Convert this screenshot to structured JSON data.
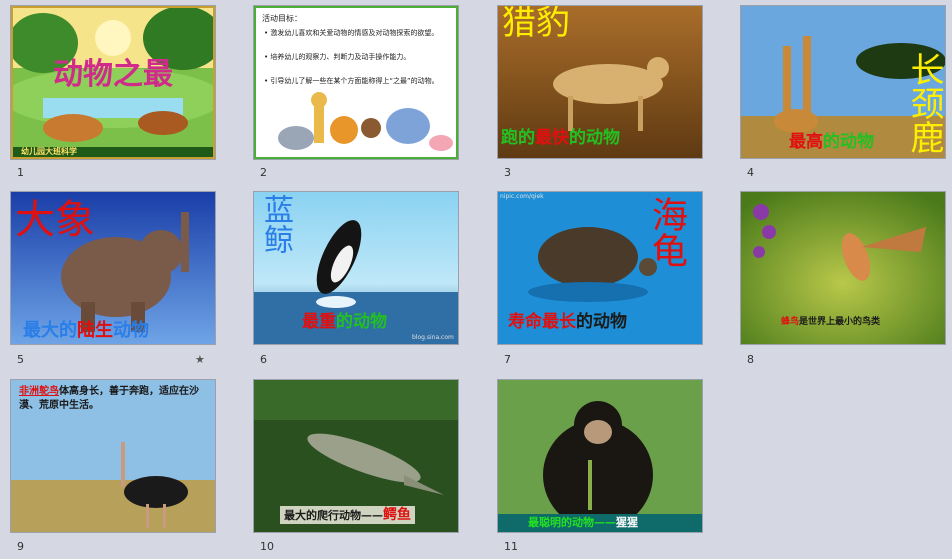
{
  "slides": [
    {
      "num": "1",
      "title": "动物之最",
      "footer": "幼儿园大班科学"
    },
    {
      "num": "2",
      "heading": "活动目标：",
      "bullets": [
        "激发幼儿喜欢和关爱动物的情感及对动物探索的欲望。",
        "培养幼儿的观察力、判断力及动手操作能力。",
        "引导幼儿了解一些在某个方面能称得上“之最”的动物。"
      ]
    },
    {
      "num": "3",
      "title": "猎豹",
      "cap_a": "跑的",
      "cap_b": "最快",
      "cap_c": "的动物"
    },
    {
      "num": "4",
      "title": "长颈鹿",
      "cap_a": "最高",
      "cap_b": "的动物"
    },
    {
      "num": "5",
      "title": "大象",
      "cap_a": "最大的",
      "cap_b": "陆生",
      "cap_c": "动物",
      "star": "★"
    },
    {
      "num": "6",
      "title": "蓝鲸",
      "cap_a": "最重",
      "cap_b": "的动物",
      "watermark": "blog.sina.com"
    },
    {
      "num": "7",
      "title": "海龟",
      "cap_a": "寿命最长",
      "cap_b": "的动物",
      "watermark": "nipic.com/qiek"
    },
    {
      "num": "8",
      "cap_a": "蜂鸟",
      "cap_b": "是世界上最小的鸟类"
    },
    {
      "num": "9",
      "cap_a": "非洲鸵鸟",
      "cap_b": "体高身长，善于奔跑，适应在沙漠、荒原中生活。"
    },
    {
      "num": "10",
      "cap_a": "最大的爬行动物——",
      "cap_b": "鳄鱼"
    },
    {
      "num": "11",
      "cap_a": "最聪明的动物——",
      "cap_b": "猩猩"
    }
  ],
  "colors": {
    "background": "#d5d8e2",
    "red": "#e01010",
    "green": "#22c022",
    "blue": "#1e6fd6",
    "yellow": "#ffee00"
  }
}
